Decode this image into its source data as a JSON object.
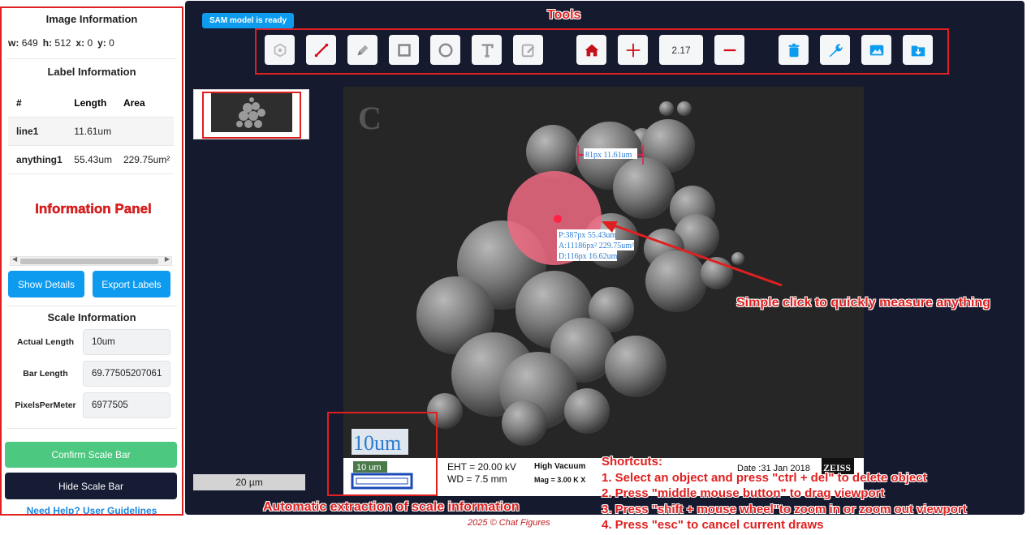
{
  "image_info": {
    "title": "Image Information",
    "w_label": "w:",
    "w": "649",
    "h_label": "h:",
    "h": "512",
    "x_label": "x:",
    "x": "0",
    "y_label": "y:",
    "y": "0"
  },
  "label_info": {
    "title": "Label Information",
    "columns": [
      "#",
      "Length",
      "Area"
    ],
    "rows": [
      {
        "name": "line1",
        "length": "11.61um",
        "area": ""
      },
      {
        "name": "anything1",
        "length": "55.43um",
        "area": "229.75um²"
      }
    ]
  },
  "panel_annotation": "Information Panel",
  "buttons": {
    "show_details": "Show Details",
    "export_labels": "Export Labels"
  },
  "scale_info": {
    "title": "Scale Information",
    "actual_length_label": "Actual Length",
    "actual_length": "10um",
    "bar_length_label": "Bar Length",
    "bar_length": "69.77505207061",
    "ppm_label": "PixelsPerMeter",
    "ppm": "6977505"
  },
  "confirm_label": "Confirm Scale Bar",
  "hide_label": "Hide Scale Bar",
  "help_label": "Need Help? User Guidelines",
  "sam_status": "SAM model is ready",
  "tools_title": "Tools",
  "zoom_value": "2.17",
  "thumbnail_scale": "20 µm",
  "image_overlay": {
    "panel_letter": "C",
    "line_label": "81px 11.61um",
    "p_label": "P:387px 55.43um",
    "a_label": "A:11186px² 229.75um²",
    "d_label": "D:116px 16.62um",
    "scale_text": "10um",
    "scale_bar_text": "10 um",
    "eht": "EHT = 20.00 kV",
    "wd": "WD =  7.5 mm",
    "vacuum": "High Vacuum",
    "mag": "Mag =  3.00 K X",
    "date": "Date :31 Jan 2018",
    "brand": "ZEISS"
  },
  "annotations": {
    "measure": "Simple click to quickly measure anything",
    "scale": "Automatic extraction of scale information",
    "shortcuts_title": "Shortcuts:",
    "shortcuts": [
      "1. Select an object and press \"ctrl + del\" to delete object",
      "2. Press \"middle mouse button\" to drag viewport",
      "3. Press \"shift + mouse wheel\"to zoom in or zoom out viewport",
      "4. Press \"esc\" to cancel current draws"
    ]
  },
  "copyright": "2025 © Chat Figures",
  "tool_icons": [
    "polygon-tool-icon",
    "line-tool-icon",
    "pen-tool-icon",
    "rectangle-tool-icon",
    "circle-tool-icon",
    "text-tool-icon",
    "edit-tool-icon",
    "home-icon",
    "crosshair-icon",
    "minus-icon",
    "trash-icon",
    "wrench-icon",
    "image-icon",
    "download-folder-icon"
  ],
  "colors": {
    "accent_blue": "#0d9bf0",
    "annotation_red": "#e02020",
    "confirm_green": "#4cc880",
    "dark_bg": "#151a2f",
    "tool_red": "#d0101a"
  }
}
